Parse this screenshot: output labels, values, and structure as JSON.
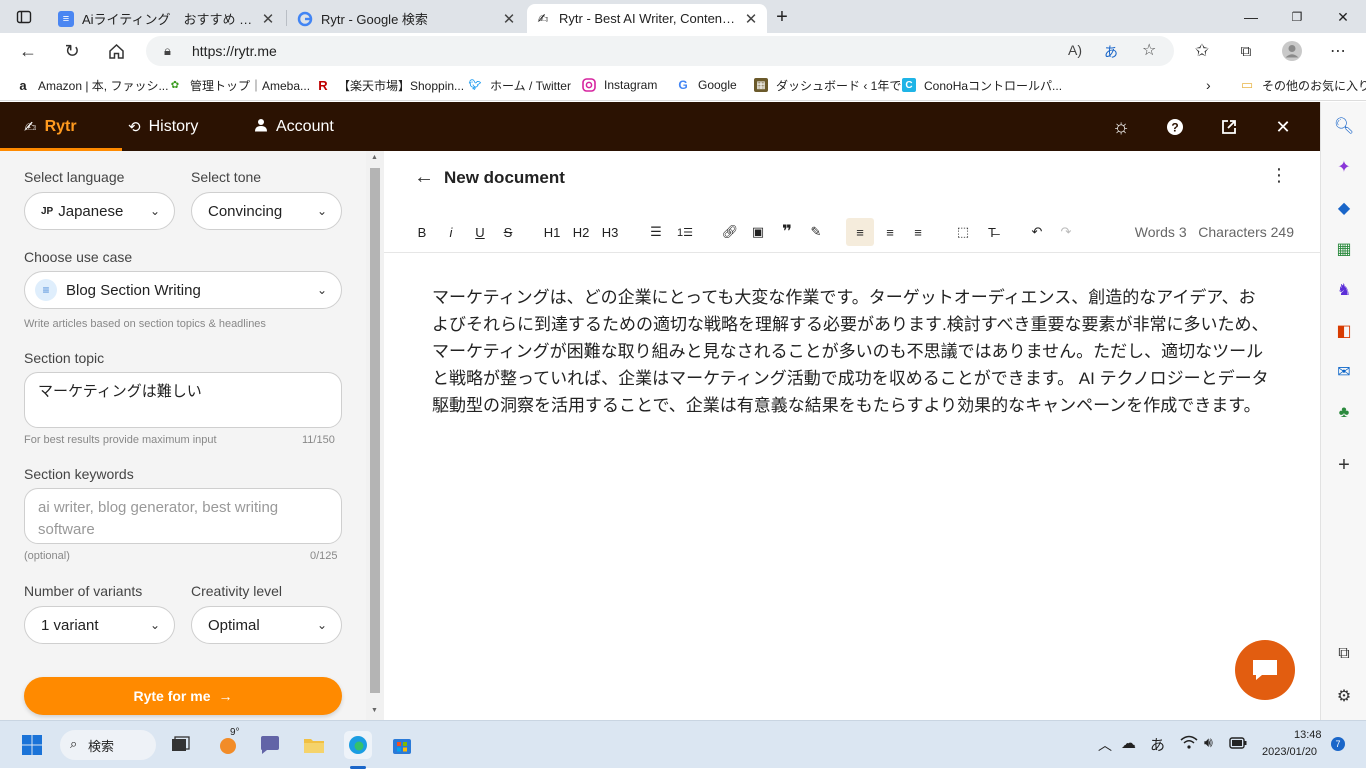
{
  "browser": {
    "tabs": [
      {
        "title": "Aiライティング　おすすめ - Google ド",
        "icon": "docs-icon",
        "active": false
      },
      {
        "title": "Rytr - Google 検索",
        "icon": "google-icon",
        "active": false
      },
      {
        "title": "Rytr - Best AI Writer, Content Gen",
        "icon": "rytr-icon",
        "active": true
      }
    ],
    "url": "https://rytr.me",
    "bookmarks": [
      {
        "label": "Amazon | 本, ファッシ...",
        "icon": "amazon-icon"
      },
      {
        "label": "管理トップ｜Ameba...",
        "icon": "ameba-icon"
      },
      {
        "label": "【楽天市場】Shoppin...",
        "icon": "rakuten-icon"
      },
      {
        "label": "ホーム / Twitter",
        "icon": "twitter-icon"
      },
      {
        "label": "Instagram",
        "icon": "instagram-icon"
      },
      {
        "label": "Google",
        "icon": "google-icon"
      },
      {
        "label": "ダッシュボード ‹ 1年で...",
        "icon": "wordpress-icon"
      },
      {
        "label": "ConoHaコントロールパ...",
        "icon": "conoha-icon"
      }
    ],
    "other_bookmarks": "その他のお気に入り"
  },
  "rytr": {
    "brand": "Rytr",
    "nav": {
      "history": "History",
      "account": "Account"
    }
  },
  "form": {
    "language_label": "Select language",
    "language_value": "Japanese",
    "language_flag": "JP",
    "tone_label": "Select tone",
    "tone_value": "Convincing",
    "usecase_label": "Choose use case",
    "usecase_value": "Blog Section Writing",
    "usecase_hint": "Write articles based on section topics & headlines",
    "topic_label": "Section topic",
    "topic_value": "マーケティングは難しい",
    "topic_hint": "For best results provide maximum input",
    "topic_count": "11/150",
    "keywords_label": "Section keywords",
    "keywords_placeholder": "ai writer, blog generator, best writing software",
    "keywords_hint": "(optional)",
    "keywords_count": "0/125",
    "variants_label": "Number of variants",
    "variants_value": "1 variant",
    "creativity_label": "Creativity level",
    "creativity_value": "Optimal",
    "ryte_button": "Ryte for me"
  },
  "document": {
    "title": "New document",
    "toolbar": {
      "bold": "B",
      "italic": "i",
      "underline": "U",
      "strike": "S",
      "h1": "H1",
      "h2": "H2",
      "h3": "H3"
    },
    "words": "Words 3",
    "characters": "Characters 249",
    "body": "マーケティングは、どの企業にとっても大変な作業です。ターゲットオーディエンス、創造的なアイデア、およびそれらに到達するための適切な戦略を理解する必要があります.検討すべき重要な要素が非常に多いため、マーケティングが困難な取り組みと見なされることが多いのも不思議ではありません。ただし、適切なツールと戦略が整っていれば、企業はマーケティング活動で成功を収めることができます。 AI テクノロジーとデータ駆動型の洞察を活用することで、企業は有意義な結果をもたらすより効果的なキャンペーンを作成できます。"
  },
  "taskbar": {
    "search": "検索",
    "weather": "9°",
    "ime": "あ",
    "time": "13:48",
    "date": "2023/01/20",
    "notifications": "7"
  },
  "colors": {
    "header": "#2b1202",
    "accent": "#ff8a00",
    "chat": "#e25d10"
  }
}
